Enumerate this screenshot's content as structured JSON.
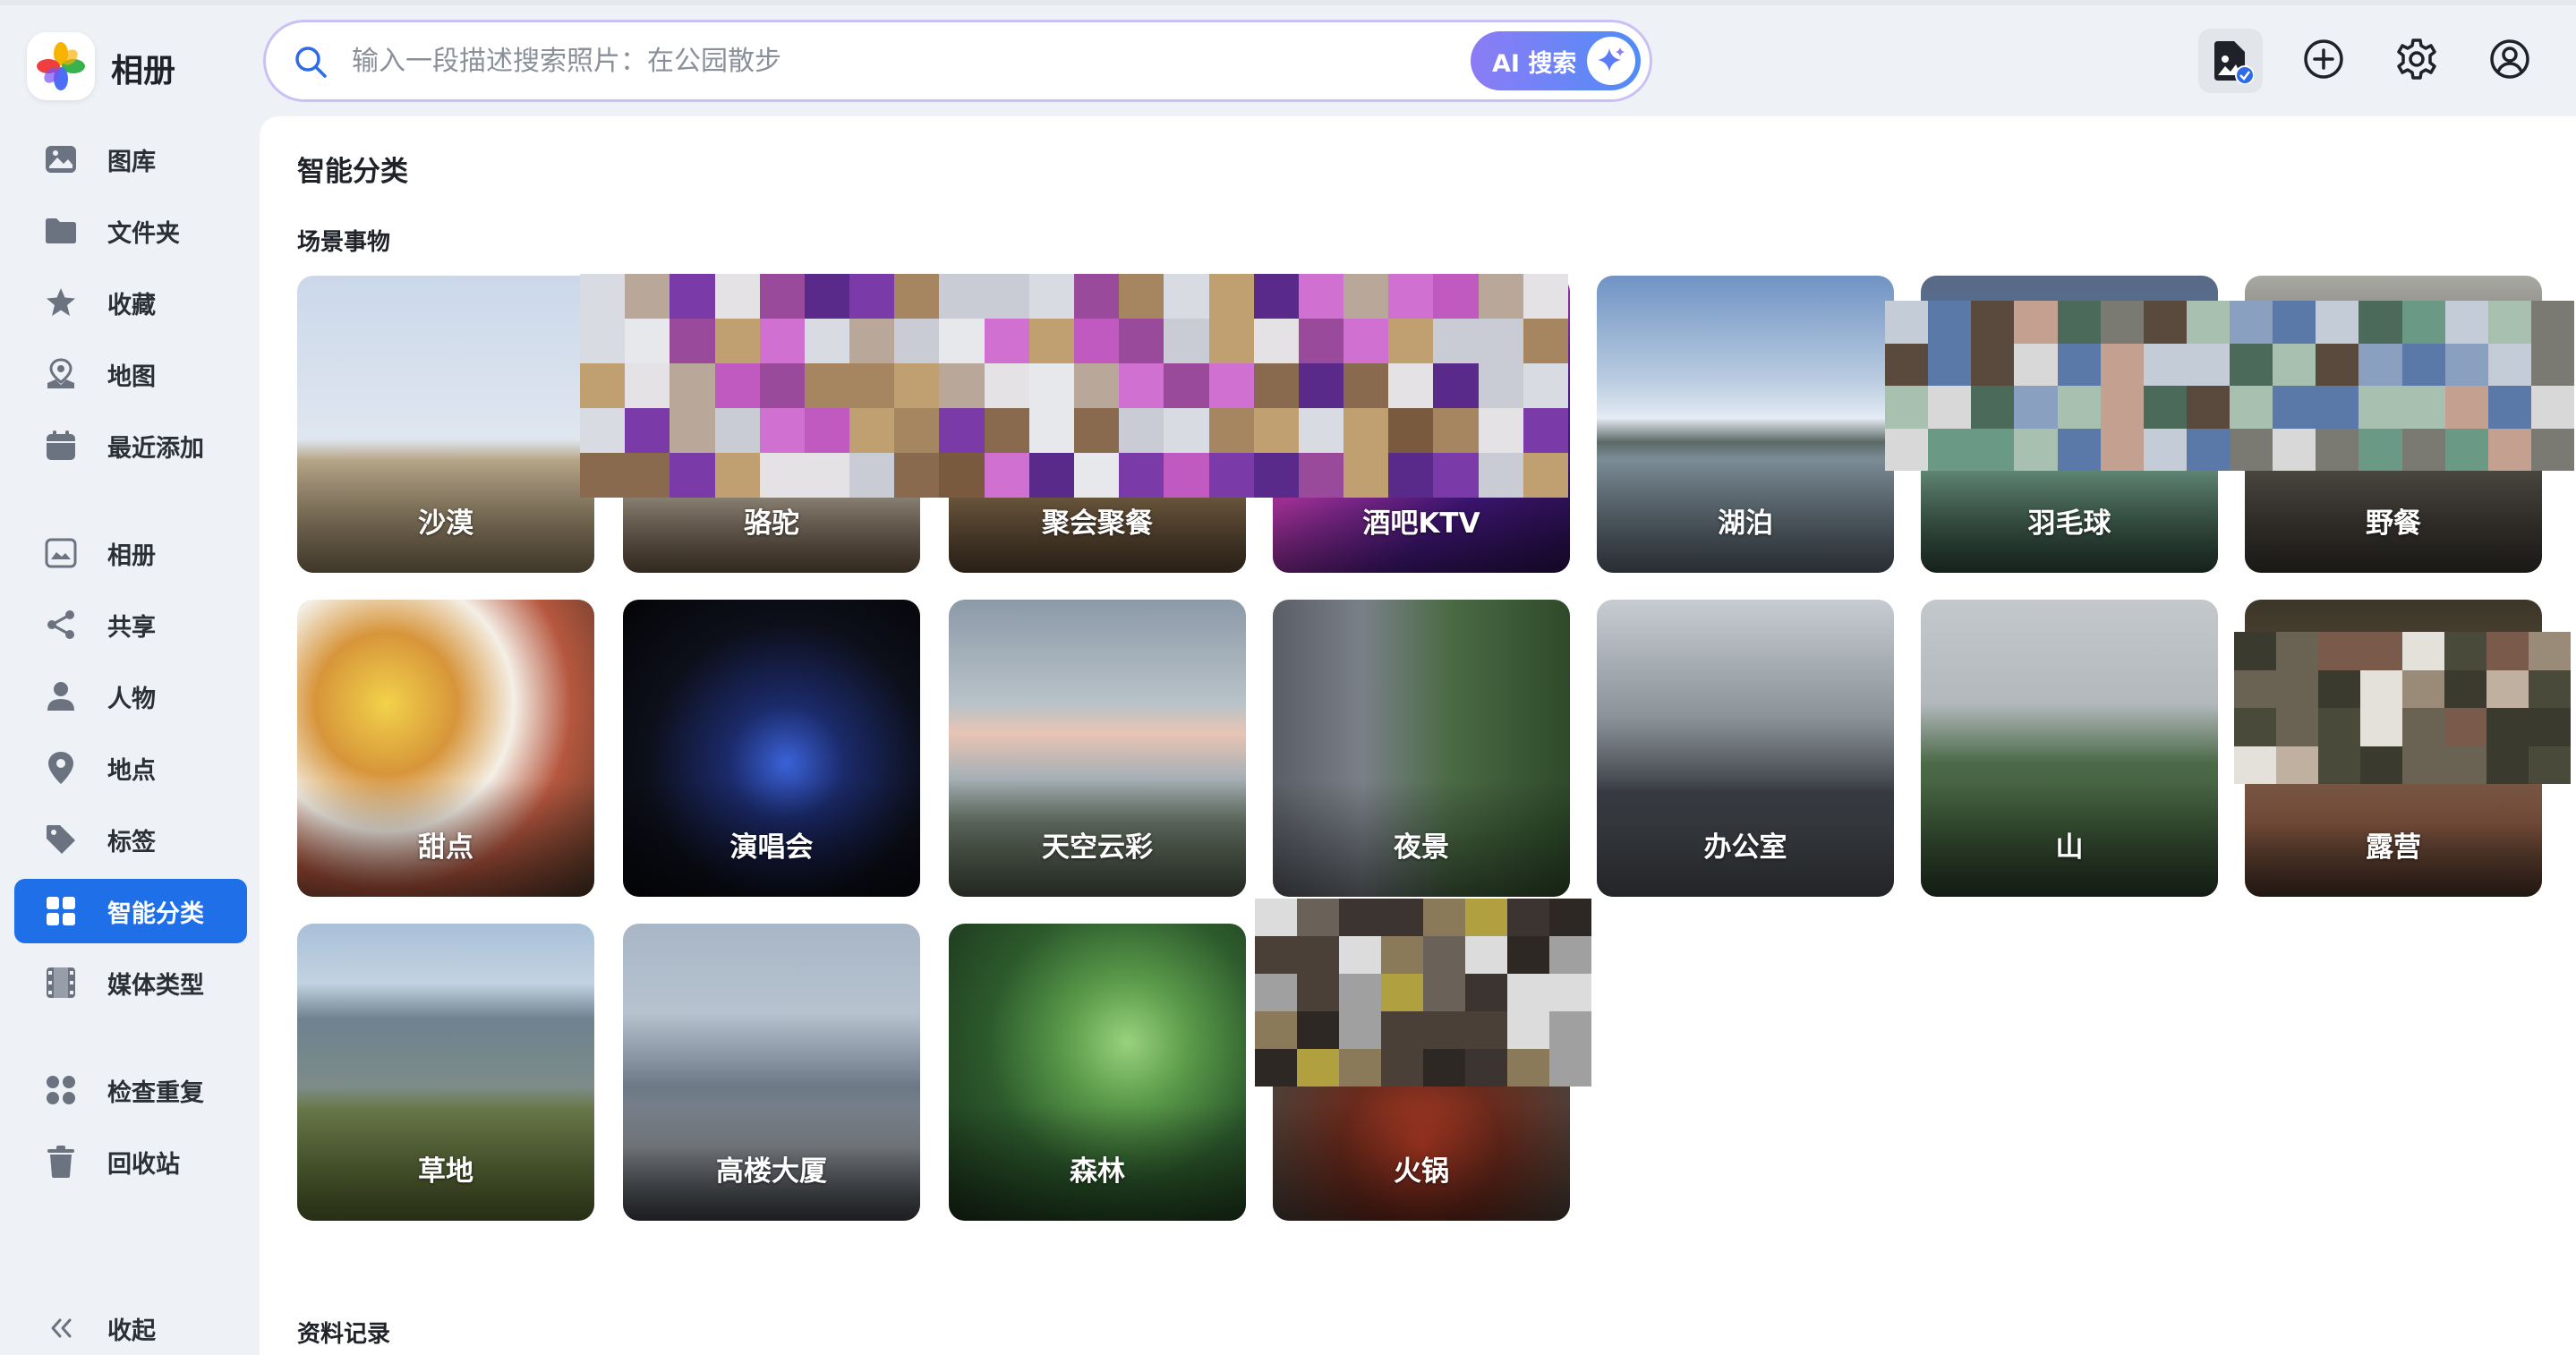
{
  "app": {
    "title": "相册"
  },
  "sidebar": {
    "items": [
      {
        "label": "图库",
        "icon": "image-icon"
      },
      {
        "label": "文件夹",
        "icon": "folder-icon"
      },
      {
        "label": "收藏",
        "icon": "star-icon"
      },
      {
        "label": "地图",
        "icon": "map-icon"
      },
      {
        "label": "最近添加",
        "icon": "calendar-icon"
      },
      {
        "label": "相册",
        "icon": "album-icon"
      },
      {
        "label": "共享",
        "icon": "share-icon"
      },
      {
        "label": "人物",
        "icon": "person-icon"
      },
      {
        "label": "地点",
        "icon": "location-pin-icon"
      },
      {
        "label": "标签",
        "icon": "tag-icon"
      },
      {
        "label": "智能分类",
        "icon": "grid-icon",
        "active": true
      },
      {
        "label": "媒体类型",
        "icon": "film-icon"
      },
      {
        "label": "检查重复",
        "icon": "duplicate-icon"
      },
      {
        "label": "回收站",
        "icon": "trash-icon"
      }
    ],
    "collapse_label": "收起"
  },
  "search": {
    "placeholder": "输入一段描述搜索照片：在公园散步",
    "ai_button_label": "AI 搜索"
  },
  "main": {
    "page_title": "智能分类",
    "section_scenes": "场景事物",
    "section_records": "资料记录",
    "scenes": [
      {
        "label": "沙漠"
      },
      {
        "label": "骆驼"
      },
      {
        "label": "聚会聚餐"
      },
      {
        "label": "酒吧KTV"
      },
      {
        "label": "湖泊"
      },
      {
        "label": "羽毛球"
      },
      {
        "label": "野餐"
      },
      {
        "label": "甜点"
      },
      {
        "label": "演唱会"
      },
      {
        "label": "天空云彩"
      },
      {
        "label": "夜景"
      },
      {
        "label": "办公室"
      },
      {
        "label": "山"
      },
      {
        "label": "露营"
      },
      {
        "label": "草地"
      },
      {
        "label": "高楼大厦"
      },
      {
        "label": "森林"
      },
      {
        "label": "火锅"
      }
    ]
  },
  "colors": {
    "accent": "#1e6fe8",
    "search_border": "#c9c1f5",
    "sidebar_bg": "#eef1f6"
  }
}
